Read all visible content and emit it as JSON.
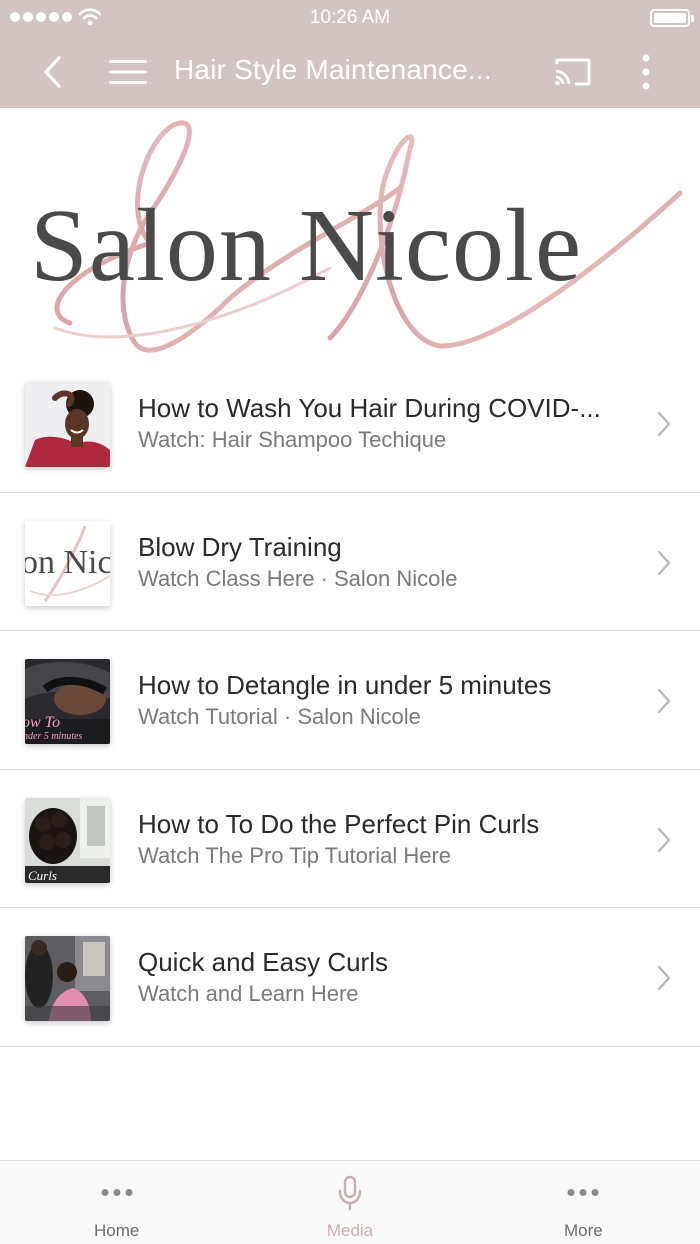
{
  "status_bar": {
    "time": "10:26 AM"
  },
  "nav": {
    "title": "Hair Style Maintenance..."
  },
  "banner": {
    "logo_text": "Salon Nicole"
  },
  "items": [
    {
      "title": "How to Wash You Hair During COVID-...",
      "subtitle": "Watch: Hair Shampoo Techique"
    },
    {
      "title": "Blow Dry Training",
      "subtitle": "Watch Class Here · Salon Nicole"
    },
    {
      "title": "How to Detangle in under 5 minutes",
      "subtitle": "Watch Tutorial  · Salon Nicole"
    },
    {
      "title": "How to To Do the Perfect Pin Curls",
      "subtitle": "Watch The Pro Tip Tutorial Here"
    },
    {
      "title": "Quick and Easy Curls",
      "subtitle": "Watch and Learn Here"
    }
  ],
  "thumbs": {
    "blow_dry": "on Nic",
    "detangle_1": "ow To",
    "detangle_2": "nder 5 minutes",
    "pin_curls": "Curls"
  },
  "tab_bar": {
    "tabs": [
      {
        "label": "Home",
        "icon": "ellipsis-icon"
      },
      {
        "label": "Media",
        "icon": "microphone-icon",
        "active": true
      },
      {
        "label": "More",
        "icon": "ellipsis-icon"
      }
    ]
  },
  "colors": {
    "header_bg": "#d3c4c3",
    "accent_rose": "#c9aeb0",
    "logo_gray": "#4a4a4a"
  }
}
